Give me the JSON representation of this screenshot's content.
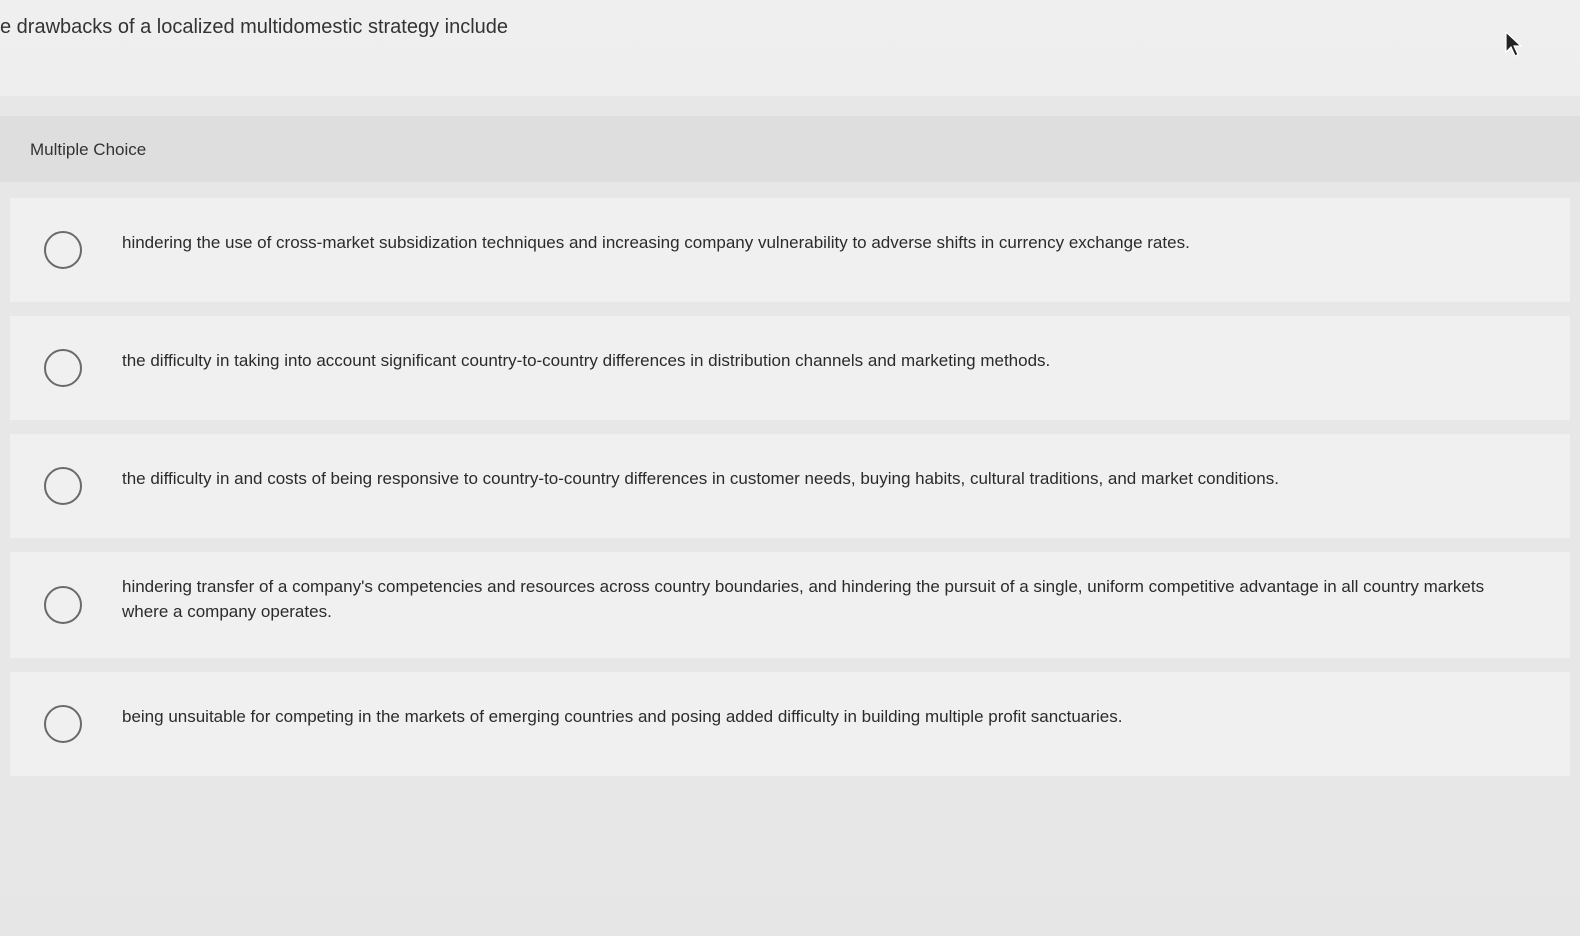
{
  "question": {
    "stem": "e drawbacks of a localized multidomestic strategy include"
  },
  "question_type": "Multiple Choice",
  "icons": {
    "cursor": "mouse-pointer-icon",
    "radio": "radio-circle-icon"
  },
  "options": [
    {
      "label": "hindering the use of cross-market subsidization techniques and increasing company vulnerability to adverse shifts in currency exchange rates."
    },
    {
      "label": "the difficulty in taking into account significant country-to-country differences in distribution channels and marketing methods."
    },
    {
      "label": "the difficulty in and costs of being responsive to country-to-country differences in customer needs, buying habits, cultural traditions, and market conditions."
    },
    {
      "label": "hindering transfer of a company's competencies and resources across country boundaries, and hindering the pursuit of a single, uniform competitive advantage in all country markets where a company operates."
    },
    {
      "label": "being unsuitable for competing in the markets of emerging countries and posing added difficulty in building multiple profit sanctuaries."
    }
  ]
}
